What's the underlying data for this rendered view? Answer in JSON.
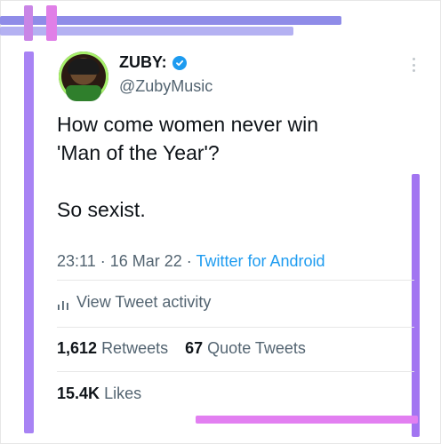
{
  "tweet": {
    "author_name": "ZUBY:",
    "handle": "@ZubyMusic",
    "text_lines": [
      "How come women never win",
      "'Man of the Year'?",
      "So sexist."
    ],
    "timestamp": "23:11 · 16 Mar 22",
    "separator": "·",
    "source": "Twitter for Android",
    "activity_label": "View Tweet activity",
    "retweets_count": "1,612",
    "retweets_label": "Retweets",
    "quote_count": "67",
    "quote_label": "Quote Tweets",
    "likes_count": "15.4K",
    "likes_label": "Likes",
    "verified_icon": "verified-badge-icon",
    "more_icon": "more-vertical-icon"
  },
  "colors": {
    "accent": "#1d9bf0",
    "text": "#0f1419",
    "muted": "#536471",
    "purple_bar": "#a178f3",
    "pink_bar": "#e27ff1"
  }
}
